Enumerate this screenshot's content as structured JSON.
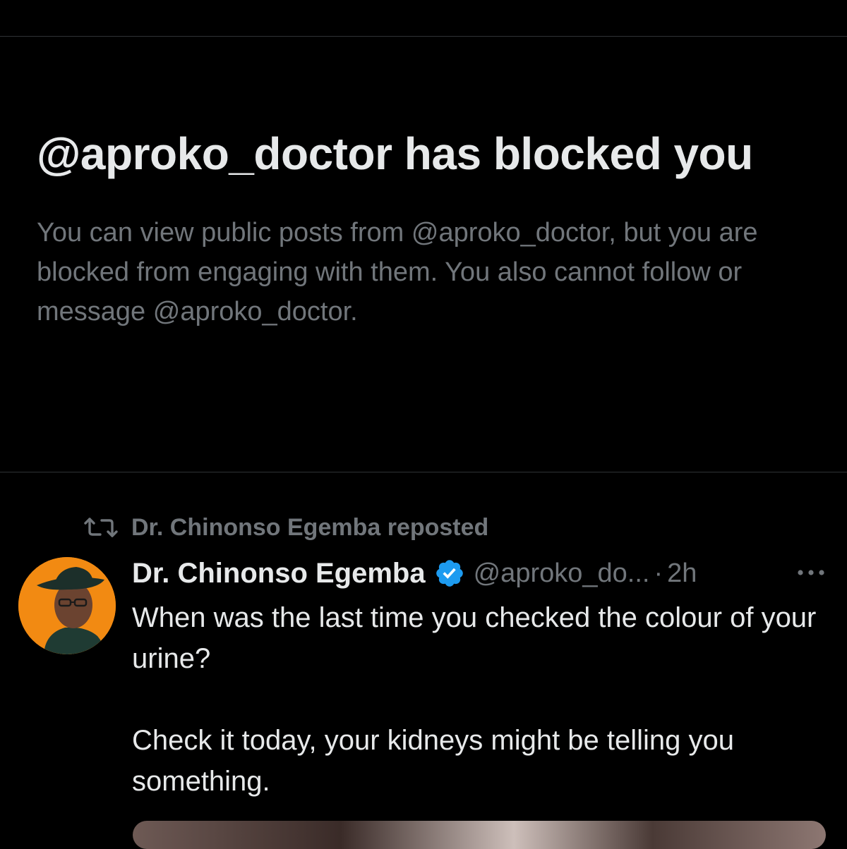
{
  "block_notice": {
    "title": "@aproko_doctor has blocked you",
    "description": "You can view public posts from @aproko_doctor, but you are blocked from engaging with them. You also cannot follow or message @aproko_doctor."
  },
  "post": {
    "repost_label": "Dr. Chinonso Egemba reposted",
    "author_name": "Dr. Chinonso Egemba",
    "author_handle": "@aproko_do...",
    "separator": "·",
    "time": "2h",
    "text_paragraphs": [
      "When was the last time you checked the colour of your urine?",
      "Check it today, your kidneys might be telling you something."
    ],
    "verified": true
  },
  "icons": {
    "repost": "repost-icon",
    "verified": "verified-badge-icon",
    "more": "more-options-icon"
  },
  "colors": {
    "background": "#000000",
    "primary_text": "#e7e9ea",
    "secondary_text": "#71767b",
    "verified_blue": "#1d9bf0",
    "avatar_bg": "#f28a12",
    "divider": "#2f3336"
  }
}
